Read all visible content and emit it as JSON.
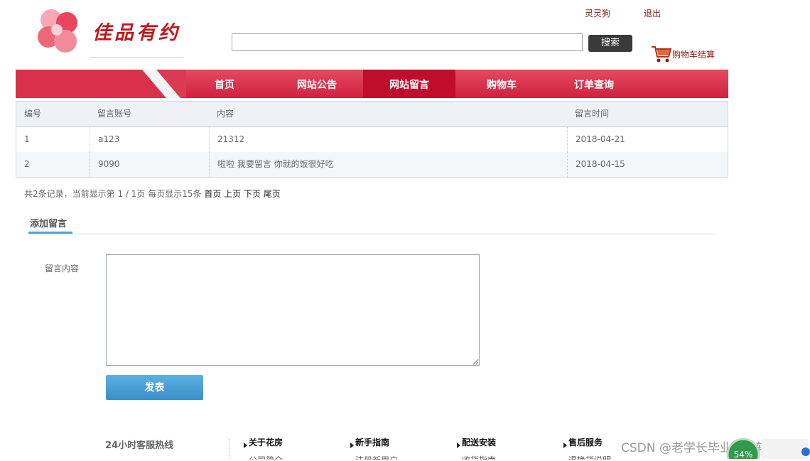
{
  "header": {
    "logo_text": "佳品有约",
    "user_link": "灵灵狗",
    "logout_link": "退出",
    "search_placeholder": "",
    "search_button": "搜索",
    "cart_link": "购物车结算"
  },
  "nav": {
    "items": [
      {
        "label": "首页"
      },
      {
        "label": "网站公告"
      },
      {
        "label": "网站留言"
      },
      {
        "label": "购物车"
      },
      {
        "label": "订单查询"
      }
    ],
    "active_index": 2,
    "colors": {
      "bar": "#d6304a",
      "active": "#c00d2b"
    }
  },
  "table": {
    "headers": [
      "编号",
      "留言账号",
      "内容",
      "留言时间"
    ],
    "rows": [
      [
        "1",
        "a123",
        "21312",
        "2018-04-21"
      ],
      [
        "2",
        "9090",
        "啦啦 我要留言 你就的饭很好吃",
        "2018-04-15"
      ]
    ]
  },
  "pager": {
    "summary": "共2条记录，当前显示第 1 / 1页 每页显示15条",
    "first": "首页",
    "prev": "上页",
    "next": "下页",
    "last": "尾页"
  },
  "form": {
    "tab_label": "添加留言",
    "content_label": "留言内容",
    "content_value": "",
    "submit_button": "发表"
  },
  "footer": {
    "hotline": "24小时客服热线",
    "columns": [
      {
        "title": "关于花房",
        "sub": "公司简介"
      },
      {
        "title": "新手指南",
        "sub": "注册新用户"
      },
      {
        "title": "配送安装",
        "sub": "收货指南"
      },
      {
        "title": "售后服务",
        "sub": "退换货说明"
      }
    ]
  },
  "overlay": {
    "watermark": "CSDN @老学长毕业设计辅导",
    "speed_percent": "54%"
  }
}
